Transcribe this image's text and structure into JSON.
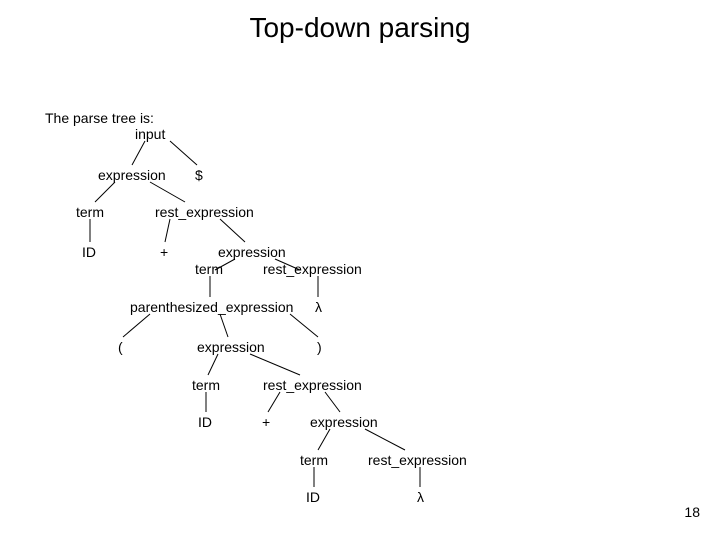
{
  "title": "Top-down parsing",
  "caption_line1": "The parse tree is:",
  "page_number": "18",
  "nodes": {
    "input": "input",
    "expression1": "expression",
    "dollar": "$",
    "term1": "term",
    "rest_expr1": "rest_expression",
    "id1": "ID",
    "plus1": "+",
    "expression2": "expression",
    "term2": "term",
    "rest_expr2": "rest_expression",
    "paren_expr": "parenthesized_expression",
    "lambda1": "λ",
    "lparen": "(",
    "expression3": "expression",
    "rparen": ")",
    "term3": "term",
    "rest_expr3": "rest_expression",
    "id2": "ID",
    "plus2": "+",
    "expression4": "expression",
    "term4": "term",
    "rest_expr4": "rest_expression",
    "id3": "ID",
    "lambda2": "λ"
  }
}
